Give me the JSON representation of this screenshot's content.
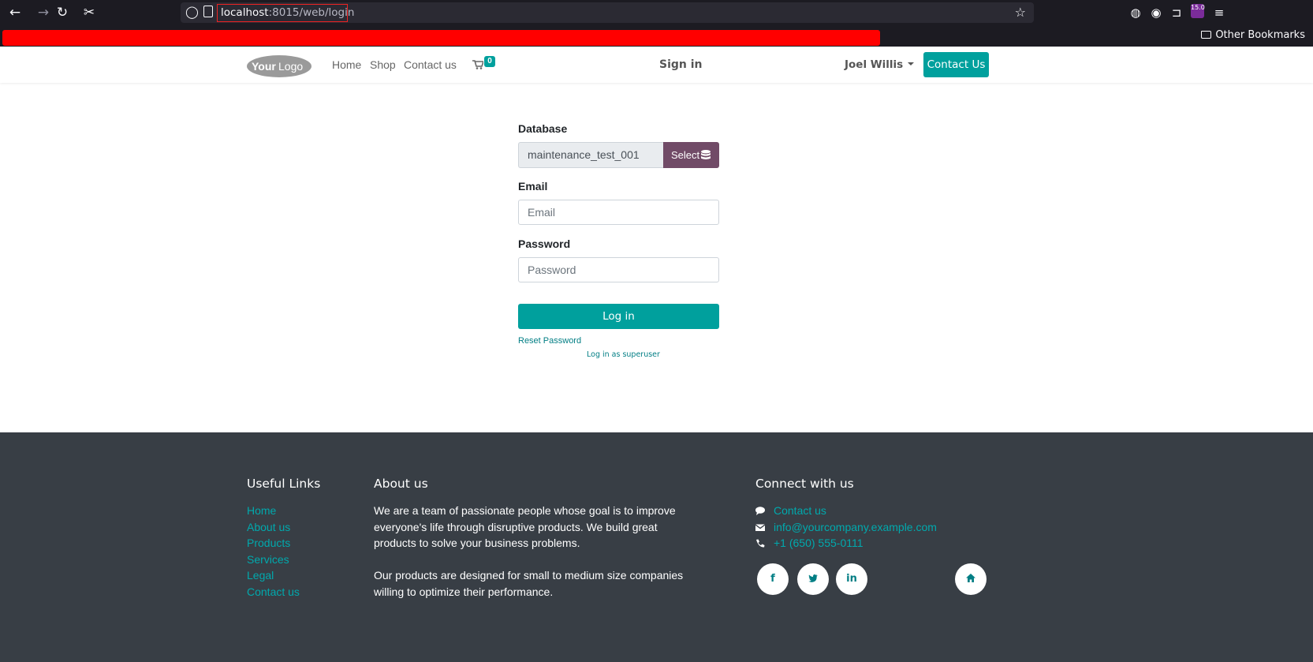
{
  "browser": {
    "url_host": "localhost",
    "url_path": ":8015/web/login",
    "other_bookmarks": "Other Bookmarks",
    "extension_badge": "15.0"
  },
  "header": {
    "logo_alt": "YourLogo",
    "nav": [
      "Home",
      "Shop",
      "Contact us"
    ],
    "cart_count": "0",
    "sign_in": "Sign in",
    "user_name": "Joel Willis",
    "contact_button": "Contact Us"
  },
  "login": {
    "database_label": "Database",
    "database_value": "maintenance_test_001",
    "select_button": "Select",
    "email_label": "Email",
    "email_placeholder": "Email",
    "password_label": "Password",
    "password_placeholder": "Password",
    "login_button": "Log in",
    "reset_password": "Reset Password",
    "superuser_link": "Log in as superuser"
  },
  "footer": {
    "useful_links_heading": "Useful Links",
    "useful_links": [
      "Home",
      "About us",
      "Products",
      "Services",
      "Legal",
      "Contact us"
    ],
    "about_heading": "About us",
    "about_p1": "We are a team of passionate people whose goal is to improve everyone's life through disruptive products. We build great products to solve your business problems.",
    "about_p2": "Our products are designed for small to medium size companies willing to optimize their performance.",
    "connect_heading": "Connect with us",
    "contact_us": "Contact us",
    "email": "info@yourcompany.example.com",
    "phone": "+1 (650) 555-0111",
    "social": [
      "f",
      "t",
      "in"
    ]
  },
  "colors": {
    "primary": "#00a09d",
    "secondary": "#714b67",
    "footer_bg": "#383e45",
    "link": "#00a9ad"
  }
}
